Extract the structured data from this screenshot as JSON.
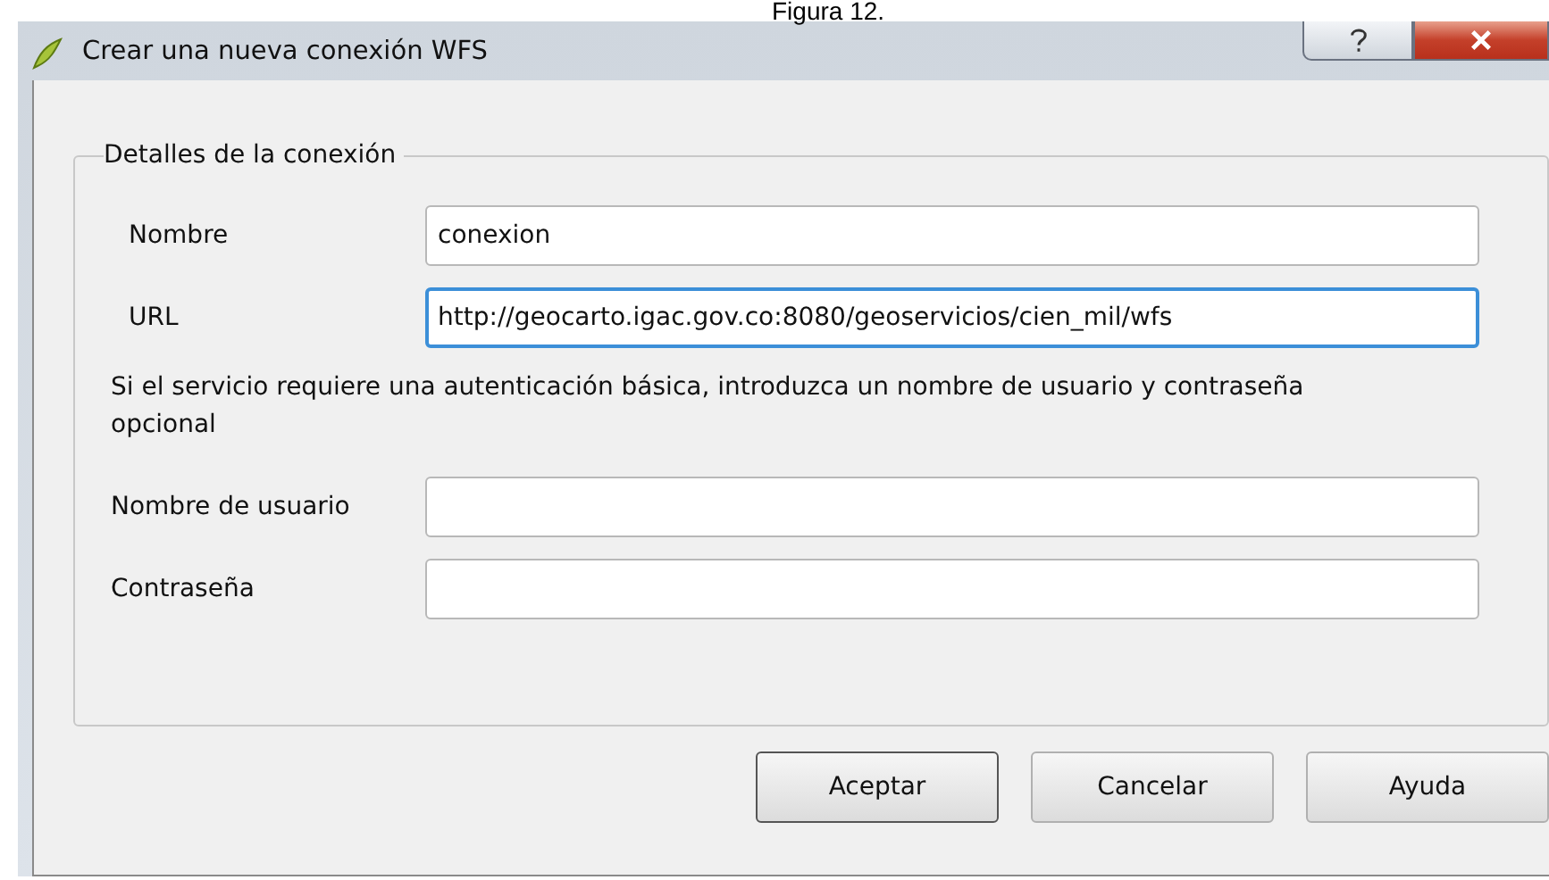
{
  "caption": "Figura 12.",
  "window": {
    "title": "Crear una nueva conexión WFS"
  },
  "group": {
    "title": "Detalles de la conexión",
    "fields": [
      {
        "label": "Nombre",
        "value": "conexion",
        "focused": false
      },
      {
        "label": "URL",
        "value": "http://geocarto.igac.gov.co:8080/geoservicios/cien_mil/wfs",
        "focused": true
      }
    ],
    "note": "Si el servicio requiere una autenticación básica, introduzca un nombre de usuario y contraseña opcional",
    "auth_fields": [
      {
        "label": "Nombre de usuario",
        "focused": false
      },
      {
        "label": "Contraseña",
        "focused": false
      }
    ]
  },
  "buttons": [
    {
      "label": "Aceptar",
      "default": true
    },
    {
      "label": "Cancelar",
      "default": false
    },
    {
      "label": "Ayuda",
      "default": false
    }
  ]
}
